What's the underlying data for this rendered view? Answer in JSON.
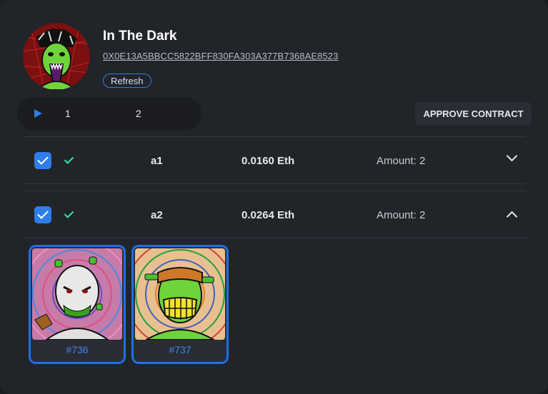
{
  "collection": {
    "title": "In The Dark",
    "address": "0X0E13A5BBCC5822BFF830FA303A377B7368AE8523",
    "refresh_label": "Refresh"
  },
  "pager": {
    "pages": [
      "1",
      "2"
    ]
  },
  "approve_label": "APPROVE CONTRACT",
  "rows": [
    {
      "name": "a1",
      "price": "0.0160 Eth",
      "amount": "Amount: 2",
      "expanded": false
    },
    {
      "name": "a2",
      "price": "0.0264 Eth",
      "amount": "Amount: 2",
      "expanded": true
    }
  ],
  "nfts": [
    {
      "label": "#736"
    },
    {
      "label": "#737"
    }
  ],
  "colors": {
    "accent": "#2f7de8",
    "success": "#3ee0b0",
    "background": "#212429"
  }
}
